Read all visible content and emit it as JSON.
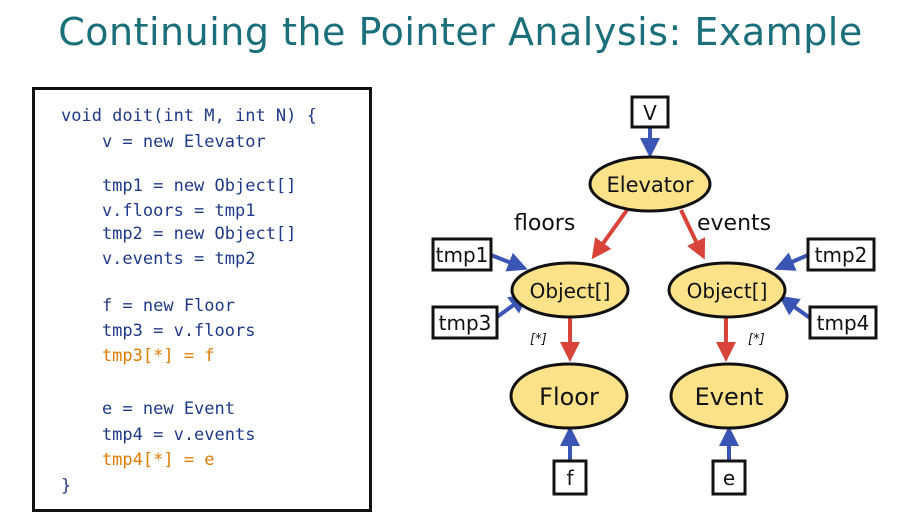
{
  "title": "Continuing the Pointer Analysis: Example",
  "code": [
    {
      "text": "void doit(int M, int N) {",
      "highlight": false
    },
    {
      "text": "    v = new Elevator",
      "highlight": false
    },
    {
      "text": "    tmp1 = new Object[]",
      "highlight": false
    },
    {
      "text": "    v.floors = tmp1",
      "highlight": false
    },
    {
      "text": "    tmp2 = new Object[]",
      "highlight": false
    },
    {
      "text": "    v.events = tmp2",
      "highlight": false
    },
    {
      "text": "    f = new Floor",
      "highlight": false
    },
    {
      "text": "    tmp3 = v.floors",
      "highlight": false
    },
    {
      "text": "    tmp3[*] = f",
      "highlight": true
    },
    {
      "text": "    e = new Event",
      "highlight": false
    },
    {
      "text": "    tmp4 = v.events",
      "highlight": false
    },
    {
      "text": "    tmp4[*] = e",
      "highlight": true
    },
    {
      "text": "}",
      "highlight": false
    }
  ],
  "diagram": {
    "nodes": {
      "elevator": "Elevator",
      "object_left": "Object[]",
      "object_right": "Object[]",
      "floor": "Floor",
      "event": "Event"
    },
    "variables": {
      "v": "V",
      "tmp1": "tmp1",
      "tmp2": "tmp2",
      "tmp3": "tmp3",
      "tmp4": "tmp4",
      "f": "f",
      "e": "e"
    },
    "edge_labels": {
      "floors": "floors",
      "events": "events",
      "index_left": "[*]",
      "index_right": "[*]"
    },
    "colors": {
      "node_fill": "#fde28a",
      "var_arrow": "#3b55b5",
      "field_arrow": "#d9443a",
      "title": "#1a6f7a",
      "code": "#1f3a8a",
      "code_highlight": "#e07b00"
    }
  }
}
